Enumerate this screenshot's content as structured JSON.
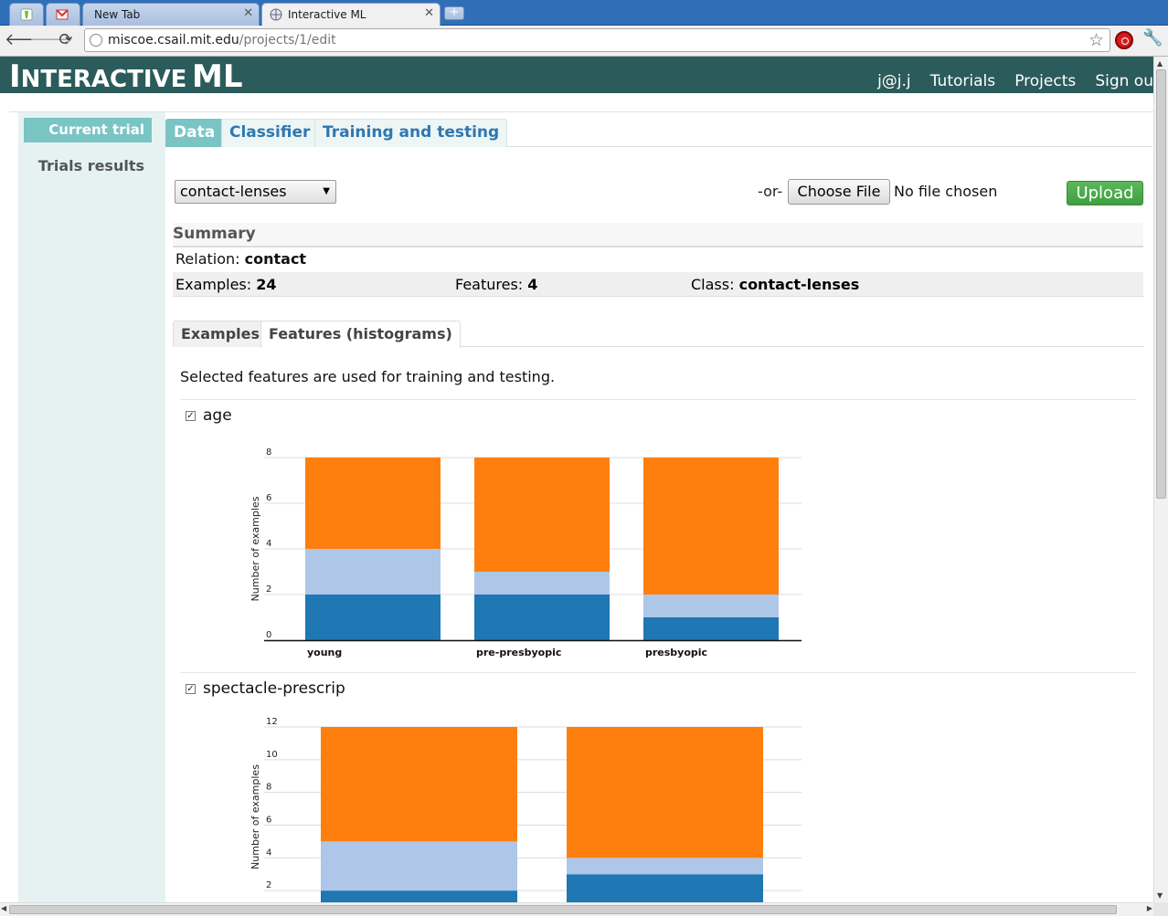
{
  "browser": {
    "tabs": [
      {
        "title": "",
        "favicon": "app-icon"
      },
      {
        "title": "",
        "favicon": "gmail-icon"
      },
      {
        "title": "New Tab",
        "favicon": ""
      },
      {
        "title": "Interactive ML",
        "favicon": "globe-icon",
        "active": true
      }
    ],
    "url_host": "miscoe.csail.mit.edu",
    "url_path": "/projects/1/edit"
  },
  "app": {
    "brand_first": "I",
    "brand_rest": "NTERACTIVE",
    "brand_tail": "ML",
    "nav": [
      "j@j.j",
      "Tutorials",
      "Projects",
      "Sign ou"
    ]
  },
  "sidebar": {
    "items": [
      {
        "label": "Current trial",
        "active": true
      },
      {
        "label": "Trials results",
        "active": false
      }
    ]
  },
  "tabs": [
    "Data",
    "Classifier",
    "Training and testing"
  ],
  "dataset": {
    "selected": "contact-lenses",
    "or_label": "-or-",
    "choose_label": "Choose File",
    "no_file": "No file chosen",
    "upload_label": "Upload"
  },
  "summary": {
    "heading": "Summary",
    "relation_label": "Relation:",
    "relation_value": "contact",
    "examples_label": "Examples:",
    "examples_value": "24",
    "features_label": "Features:",
    "features_value": "4",
    "class_label": "Class:",
    "class_value": "contact-lenses"
  },
  "subtabs": [
    "Examples",
    "Features (histograms)"
  ],
  "note": "Selected features are used for training and testing.",
  "features": [
    {
      "name": "age",
      "checked": true
    },
    {
      "name": "spectacle-prescrip",
      "checked": true
    }
  ],
  "colors": {
    "dark": "#1f77b4",
    "light": "#aec7e8",
    "orange": "#ff7f0e"
  },
  "chart_data": [
    {
      "type": "bar",
      "stacked": true,
      "ylabel": "Number of examples",
      "ylim": [
        0,
        8
      ],
      "yticks": [
        0,
        2,
        4,
        6,
        8
      ],
      "categories": [
        "young",
        "pre-presbyopic",
        "presbyopic"
      ],
      "series": [
        {
          "values": [
            2,
            2,
            1
          ]
        },
        {
          "values": [
            2,
            1,
            1
          ]
        },
        {
          "values": [
            4,
            5,
            6
          ]
        }
      ]
    },
    {
      "type": "bar",
      "stacked": true,
      "ylabel": "Number of examples",
      "ylim": [
        0,
        12
      ],
      "yticks": [
        2,
        4,
        6,
        8,
        10,
        12
      ],
      "categories": [
        "",
        ""
      ],
      "series": [
        {
          "values": [
            2,
            3
          ]
        },
        {
          "values": [
            3,
            1
          ]
        },
        {
          "values": [
            7,
            8
          ]
        }
      ]
    }
  ]
}
